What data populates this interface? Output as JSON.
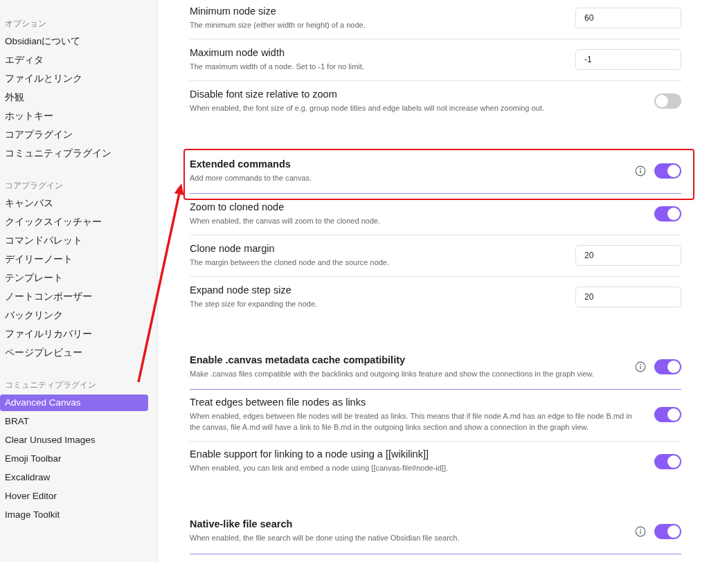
{
  "sidebar": {
    "sections": [
      {
        "label": "オプション",
        "items": [
          {
            "label": "Obsidianについて",
            "selected": false
          },
          {
            "label": "エディタ",
            "selected": false
          },
          {
            "label": "ファイルとリンク",
            "selected": false
          },
          {
            "label": "外観",
            "selected": false
          },
          {
            "label": "ホットキー",
            "selected": false
          },
          {
            "label": "コアプラグイン",
            "selected": false
          },
          {
            "label": "コミュニティプラグイン",
            "selected": false
          }
        ]
      },
      {
        "label": "コアプラグイン",
        "items": [
          {
            "label": "キャンバス",
            "selected": false
          },
          {
            "label": "クイックスイッチャー",
            "selected": false
          },
          {
            "label": "コマンドパレット",
            "selected": false
          },
          {
            "label": "デイリーノート",
            "selected": false
          },
          {
            "label": "テンプレート",
            "selected": false
          },
          {
            "label": "ノートコンポーザー",
            "selected": false
          },
          {
            "label": "バックリンク",
            "selected": false
          },
          {
            "label": "ファイルリカバリー",
            "selected": false
          },
          {
            "label": "ページプレビュー",
            "selected": false
          }
        ]
      },
      {
        "label": "コミュニティプラグイン",
        "items": [
          {
            "label": "Advanced Canvas",
            "selected": true
          },
          {
            "label": "BRAT",
            "selected": false
          },
          {
            "label": "Clear Unused Images",
            "selected": false
          },
          {
            "label": "Emoji Toolbar",
            "selected": false
          },
          {
            "label": "Excalidraw",
            "selected": false
          },
          {
            "label": "Hover Editor",
            "selected": false
          },
          {
            "label": "Image Toolkit",
            "selected": false
          }
        ]
      }
    ]
  },
  "settings": {
    "groups": [
      {
        "rows": [
          {
            "kind": "number",
            "heading": false,
            "title": "Minimum node size",
            "description": "The minimum size (either width or height) of a node.",
            "value": "60"
          },
          {
            "kind": "number",
            "heading": false,
            "title": "Maximum node width",
            "description": "The maximum width of a node. Set to -1 for no limit.",
            "value": "-1"
          },
          {
            "kind": "toggle",
            "heading": false,
            "title": "Disable font size relative to zoom",
            "description": "When enabled, the font size of e.g. group node titles and edge labels will not increase when zooming out.",
            "on": false
          }
        ]
      },
      {
        "rows": [
          {
            "kind": "toggle",
            "heading": true,
            "highlighted": true,
            "title": "Extended commands",
            "description": "Add more commands to the canvas.",
            "on": true
          },
          {
            "kind": "toggle",
            "heading": false,
            "title": "Zoom to cloned node",
            "description": "When enabled, the canvas will zoom to the cloned node.",
            "on": true
          },
          {
            "kind": "number",
            "heading": false,
            "title": "Clone node margin",
            "description": "The margin between the cloned node and the source node.",
            "value": "20"
          },
          {
            "kind": "number",
            "heading": false,
            "title": "Expand node step size",
            "description": "The step size for expanding the node.",
            "value": "20"
          }
        ]
      },
      {
        "rows": [
          {
            "kind": "toggle",
            "heading": true,
            "title": "Enable .canvas metadata cache compatibility",
            "description": "Make .canvas files compatible with the backlinks and outgoing links feature and show the connections in the graph view.",
            "on": true
          },
          {
            "kind": "toggle",
            "heading": false,
            "title": "Treat edges between file nodes as links",
            "description": "When enabled, edges between file nodes will be treated as links. This means that if file node A.md has an edge to file node B.md in the canvas, file A.md will have a link to file B.md in the outgoing links section and show a connection in the graph view.",
            "on": true
          },
          {
            "kind": "toggle",
            "heading": false,
            "title": "Enable support for linking to a node using a [[wikilink]]",
            "description": "When enabled, you can link and embed a node using [[canvas-file#node-id]].",
            "on": true
          }
        ]
      },
      {
        "rows": [
          {
            "kind": "toggle",
            "heading": true,
            "title": "Native-like file search",
            "description": "When enabled, the file search will be done using the native Obsidian file search.",
            "on": true
          }
        ]
      }
    ]
  }
}
